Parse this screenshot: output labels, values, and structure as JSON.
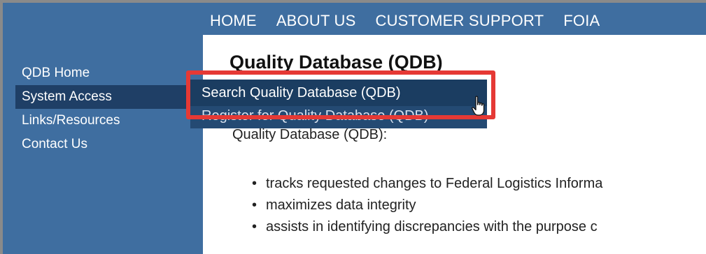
{
  "top_nav": [
    "HOME",
    "ABOUT US",
    "CUSTOMER SUPPORT",
    "FOIA"
  ],
  "sidebar": {
    "items": [
      {
        "label": "QDB Home"
      },
      {
        "label": "System Access"
      },
      {
        "label": "Links/Resources"
      },
      {
        "label": "Contact Us"
      }
    ]
  },
  "main": {
    "title": "Quality Database (QDB)",
    "intro": "Quality Database (QDB):",
    "bullets": [
      "tracks requested changes to Federal Logistics Informa",
      "maximizes data integrity",
      "assists in identifying discrepancies with the purpose c"
    ]
  },
  "dropdown": {
    "items": [
      {
        "label": "Search Quality Database (QDB)"
      },
      {
        "label": "Register for Quality Database (QDB)"
      }
    ]
  },
  "colors": {
    "nav_blue": "#3f6ea0",
    "menu_dark": "#244a73",
    "highlight_red": "#e53935"
  },
  "icons": {
    "pointer": "hand-pointer-icon"
  }
}
